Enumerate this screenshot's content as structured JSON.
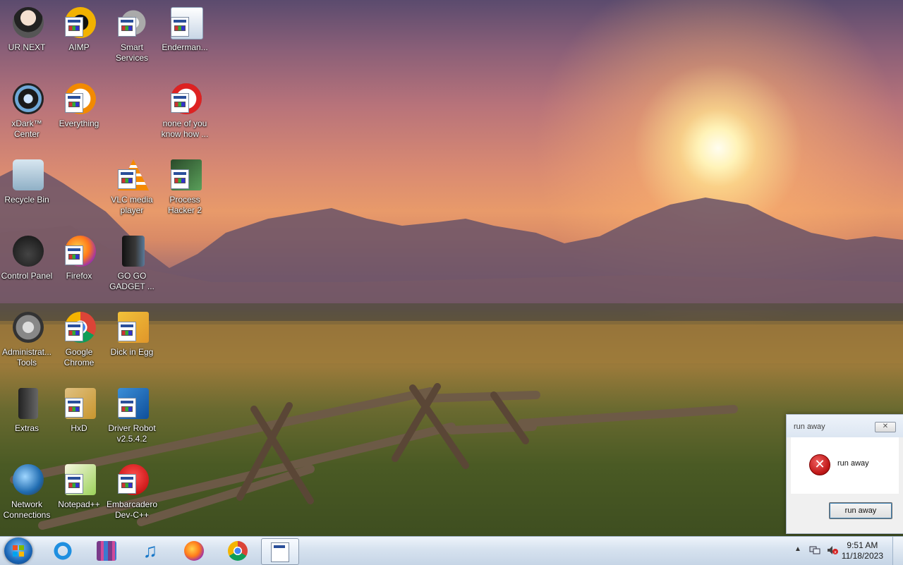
{
  "desktop": {
    "icons": [
      {
        "label": "UR NEXT",
        "icon": "character-icon"
      },
      {
        "label": "AIMP",
        "icon": "aimp-icon"
      },
      {
        "label": "Smart Services",
        "icon": "gear-shortcut-icon"
      },
      {
        "label": "Enderman...",
        "icon": "program-icon"
      },
      {
        "label": "xDark™ Center",
        "icon": "xdark-icon"
      },
      {
        "label": "Everything",
        "icon": "everything-icon"
      },
      {
        "label": "none of you know how ...",
        "icon": "program-icon"
      },
      {
        "label": "Recycle Bin",
        "icon": "recycle-bin-icon"
      },
      {
        "label": "VLC media player",
        "icon": "vlc-icon"
      },
      {
        "label": "Process Hacker 2",
        "icon": "process-hacker-icon"
      },
      {
        "label": "Control Panel",
        "icon": "control-panel-icon"
      },
      {
        "label": "Firefox",
        "icon": "firefox-icon"
      },
      {
        "label": "GO GO GADGET ...",
        "icon": "program-icon"
      },
      {
        "label": "Administrat... Tools",
        "icon": "admin-tools-icon"
      },
      {
        "label": "Google Chrome",
        "icon": "chrome-icon"
      },
      {
        "label": "Dick in Egg",
        "icon": "program-icon"
      },
      {
        "label": "Extras",
        "icon": "extras-icon"
      },
      {
        "label": "HxD",
        "icon": "hxd-icon"
      },
      {
        "label": "Driver Robot v2.5.4.2",
        "icon": "driver-robot-icon"
      },
      {
        "label": "Network Connections",
        "icon": "network-icon"
      },
      {
        "label": "Notepad++",
        "icon": "notepad-plus-icon"
      },
      {
        "label": "Embarcadero Dev-C++",
        "icon": "devcpp-icon"
      }
    ]
  },
  "dialog": {
    "title": "run away",
    "close_label": "✕",
    "message": "run away",
    "button_label": "run away"
  },
  "taskbar": {
    "start": "windows-start-icon",
    "pinned": [
      "internet-explorer-icon",
      "winrar-icon",
      "music-icon",
      "firefox-icon",
      "chrome-icon"
    ],
    "active": "program-icon",
    "tray_arrow": "▲",
    "clock_time": "9:51 AM",
    "clock_date": "11/18/2023"
  },
  "colors": {
    "taskbar": "#d6e2ef",
    "error_red": "#c01818",
    "sky_orange": "#e89a6a"
  }
}
